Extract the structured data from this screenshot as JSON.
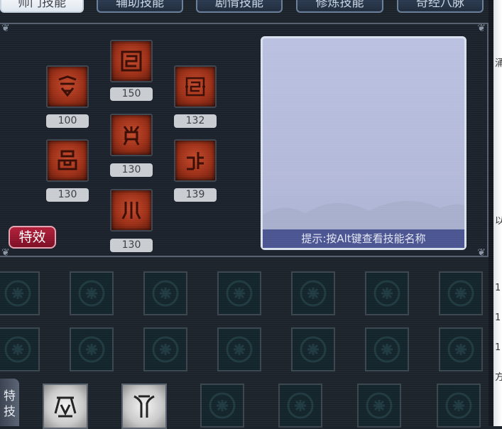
{
  "tabs": [
    {
      "label": "师门技能",
      "active": true
    },
    {
      "label": "辅助技能",
      "active": false
    },
    {
      "label": "剧情技能",
      "active": false
    },
    {
      "label": "修炼技能",
      "active": false
    },
    {
      "label": "奇经八脉",
      "active": false
    }
  ],
  "skills": [
    {
      "level": "150",
      "icon": "skill-rune-icon"
    },
    {
      "level": "100",
      "icon": "skill-rune-icon"
    },
    {
      "level": "132",
      "icon": "skill-rune-icon"
    },
    {
      "level": "130",
      "icon": "skill-rune-icon"
    },
    {
      "level": "130",
      "icon": "skill-rune-icon"
    },
    {
      "level": "139",
      "icon": "skill-rune-icon"
    },
    {
      "level": "130",
      "icon": "skill-rune-icon"
    }
  ],
  "effects_button": "特效",
  "description_panel": {
    "hint": "提示:按Alt键查看技能名称"
  },
  "stunt_label": "特技",
  "side_strip_chars": [
    "涌",
    "以",
    "1",
    "1",
    "1",
    "方"
  ],
  "colors": {
    "skill_icon": "#9b2f17",
    "level_badge": "#c9ccd1",
    "effects_button": "#b21f3a",
    "hint_bar": "#4b5592",
    "description_bg": "#b3b9d8"
  }
}
